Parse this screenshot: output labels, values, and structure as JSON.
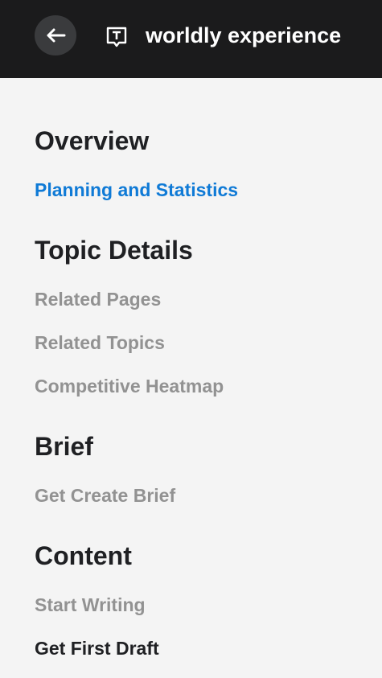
{
  "header": {
    "back_icon": "arrow-left-icon",
    "topic_icon": "text-bubble-icon",
    "title": "worldly experience"
  },
  "sections": [
    {
      "title": "Overview",
      "items": [
        {
          "label": "Planning and Statistics",
          "state": "active"
        }
      ]
    },
    {
      "title": "Topic Details",
      "items": [
        {
          "label": "Related Pages",
          "state": "muted"
        },
        {
          "label": "Related Topics",
          "state": "muted"
        },
        {
          "label": "Competitive Heatmap",
          "state": "muted"
        }
      ]
    },
    {
      "title": "Brief",
      "items": [
        {
          "label": "Get Create Brief",
          "state": "muted"
        }
      ]
    },
    {
      "title": "Content",
      "items": [
        {
          "label": "Start Writing",
          "state": "muted"
        },
        {
          "label": "Get First Draft",
          "state": "dark"
        }
      ]
    }
  ],
  "colors": {
    "header_bg": "#1b1b1c",
    "page_bg": "#f4f4f4",
    "active": "#0f7ad6",
    "muted": "#929292",
    "dark": "#1f2023"
  }
}
